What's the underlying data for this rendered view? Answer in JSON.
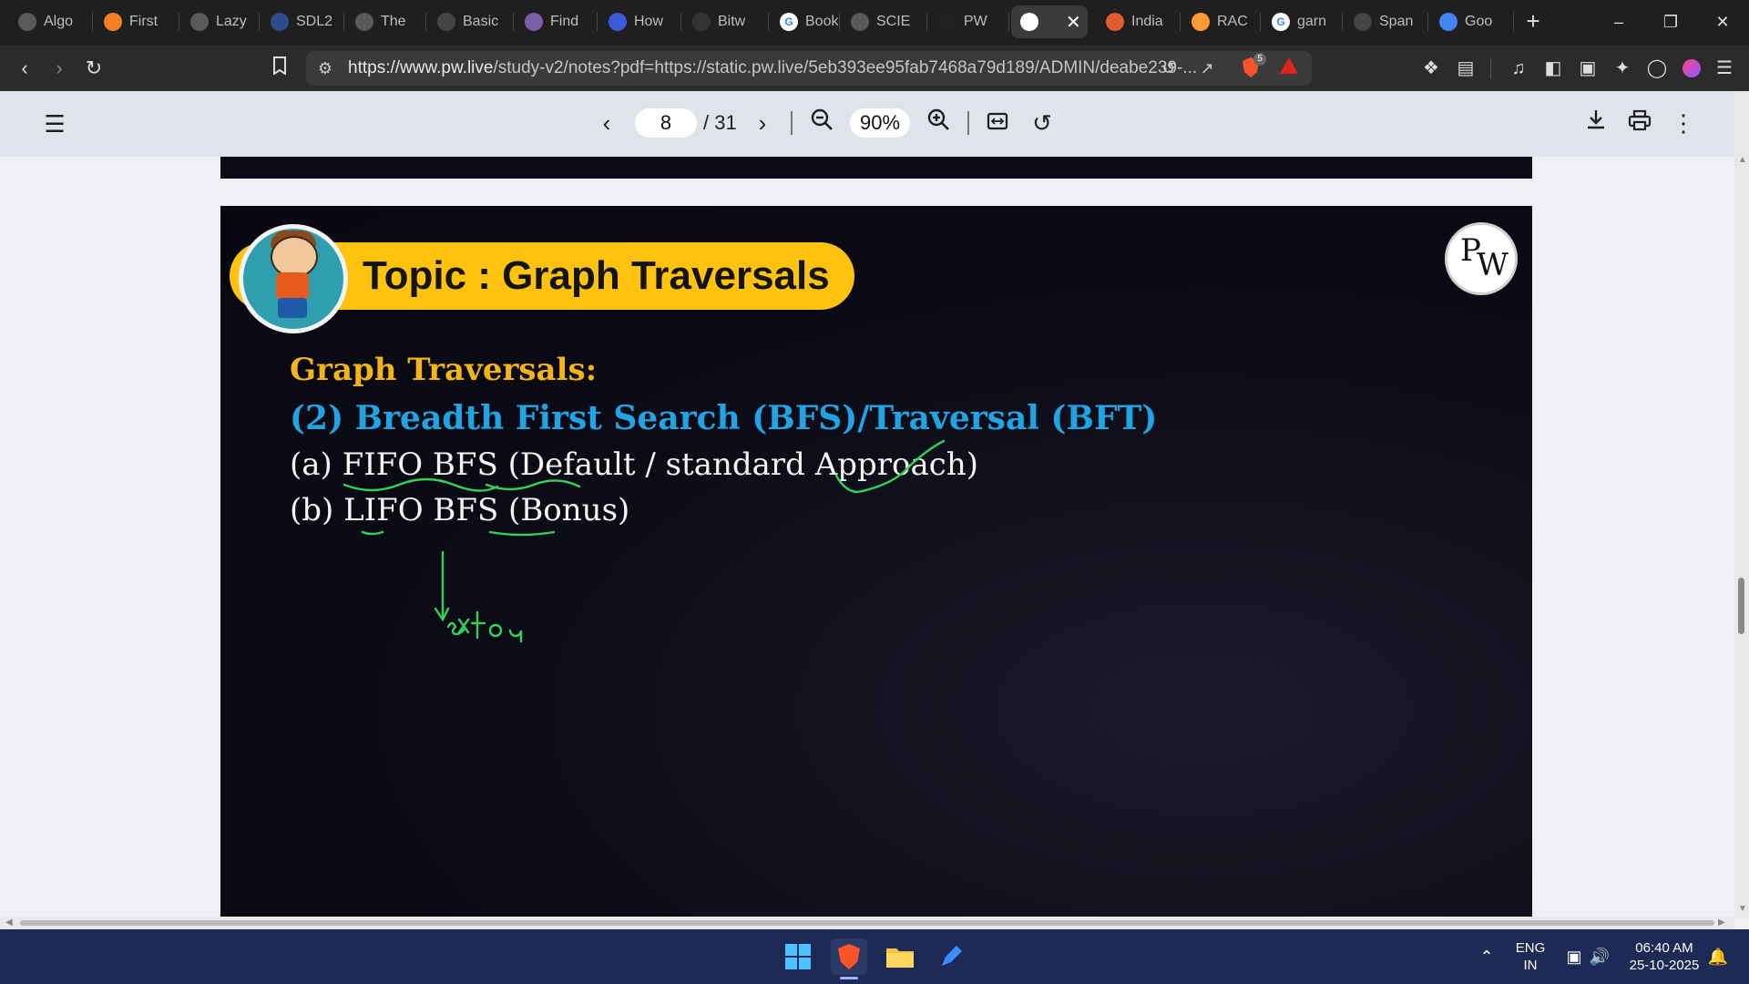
{
  "browser": {
    "tabs": [
      {
        "title": "Algo",
        "icon": "globe-icon"
      },
      {
        "title": "First",
        "icon": "stack-icon"
      },
      {
        "title": "Lazy",
        "icon": "globe-icon"
      },
      {
        "title": "SDL2",
        "icon": "sdl-icon"
      },
      {
        "title": "The",
        "icon": "globe-icon"
      },
      {
        "title": "Basic",
        "icon": "grid-icon"
      },
      {
        "title": "Find",
        "icon": "brain-icon"
      },
      {
        "title": "How",
        "icon": "bookmark-icon"
      },
      {
        "title": "Bitw",
        "icon": "code-icon"
      },
      {
        "title": "Book",
        "icon": "google-icon"
      },
      {
        "title": "SCIE",
        "icon": "globe-icon"
      },
      {
        "title": "PW",
        "icon": "pw-icon"
      },
      {
        "title": "",
        "icon": "pw-notes-icon",
        "active": true
      },
      {
        "title": "India",
        "icon": "india-icon"
      },
      {
        "title": "RAC",
        "icon": "flag-icon"
      },
      {
        "title": "garn",
        "icon": "google-icon"
      },
      {
        "title": "Span",
        "icon": "openai-icon"
      },
      {
        "title": "Goo",
        "icon": "gemini-icon"
      }
    ],
    "url_host": "https://www.pw.live",
    "url_rest": "/study-v2/notes?pdf=https://static.pw.live/5eb393ee95fab7468a79d189/ADMIN/deabe239-...",
    "shield_count": "5"
  },
  "pdf_toolbar": {
    "current_page": "8",
    "page_count": "/ 31",
    "zoom": "90%"
  },
  "slide": {
    "topic_title": "Topic : Graph Traversals",
    "heading": "Graph Traversals:",
    "subheading": "(2) Breadth First Search (BFS)/Traversal (BFT)",
    "item_a": "(a)  FIFO BFS (Default / standard Approach)",
    "item_b": "(b)  LIFO BFS (Bonus)",
    "logo_p": "P",
    "logo_w": "W",
    "handwritten_note": "extra"
  },
  "taskbar": {
    "lang_line1": "ENG",
    "lang_line2": "IN",
    "time": "06:40 AM",
    "date": "25-10-2025"
  }
}
